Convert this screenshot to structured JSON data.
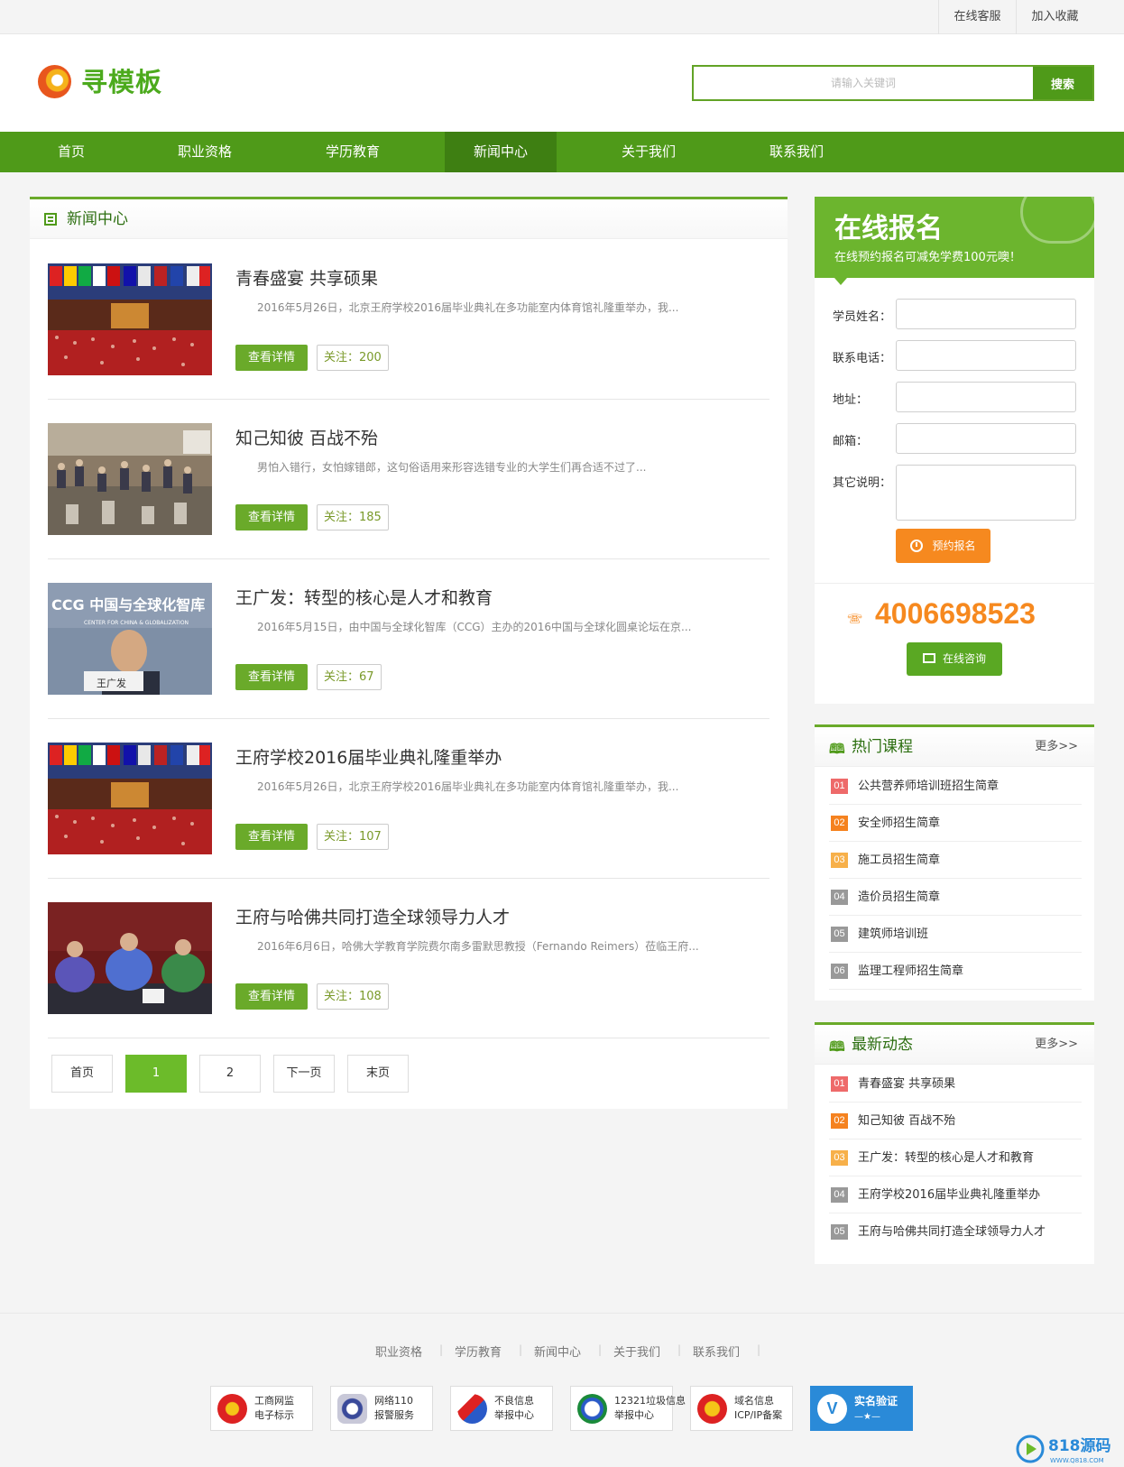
{
  "topbar": {
    "links": [
      "在线客服",
      "加入收藏"
    ]
  },
  "header": {
    "logo_text": "寻模板",
    "search_placeholder": "请输入关键词",
    "search_button": "搜索"
  },
  "nav": {
    "items": [
      "首页",
      "职业资格",
      "学历教育",
      "新闻中心",
      "关于我们",
      "联系我们"
    ],
    "active": "新闻中心"
  },
  "main": {
    "section_title": "新闻中心",
    "articles": [
      {
        "title": "青春盛宴 共享硕果",
        "desc": "2016年5月26日，北京王府学校2016届毕业典礼在多功能室内体育馆礼隆重举办，我...",
        "button": "查看详情",
        "follow": "关注：200"
      },
      {
        "title": "知己知彼 百战不殆",
        "desc": "男怕入错行，女怕嫁错郎，这句俗语用来形容选错专业的大学生们再合适不过了...",
        "button": "查看详情",
        "follow": "关注：185"
      },
      {
        "title": "王广发：转型的核心是人才和教育",
        "desc": "2016年5月15日，由中国与全球化智库（CCG）主办的2016中国与全球化圆桌论坛在京...",
        "button": "查看详情",
        "follow": "关注：67"
      },
      {
        "title": "王府学校2016届毕业典礼隆重举办",
        "desc": "2016年5月26日，北京王府学校2016届毕业典礼在多功能室内体育馆礼隆重举办，我...",
        "button": "查看详情",
        "follow": "关注：107"
      },
      {
        "title": "王府与哈佛共同打造全球领导力人才",
        "desc": "2016年6月6日，哈佛大学教育学院费尔南多雷默思教授（Fernando Reimers）莅临王府...",
        "button": "查看详情",
        "follow": "关注：108"
      }
    ],
    "image_texts": {
      "ccg": "CCG 中国与全球化智库",
      "ccg_sub": "CENTER FOR CHINA & GLOBALIZATION",
      "name_card": "王广发"
    },
    "pager": [
      "首页",
      "1",
      "2",
      "下一页",
      "末页"
    ]
  },
  "signup": {
    "title": "在线报名",
    "subtitle": "在线预约报名可减免学费100元噢！",
    "fields": [
      "学员姓名：",
      "联系电话：",
      "地址：",
      "邮箱：",
      "其它说明："
    ],
    "submit": "预约报名",
    "phone": "4006698523",
    "consult": "在线咨询"
  },
  "hot_courses": {
    "title": "热门课程",
    "more": "更多>>",
    "items": [
      {
        "num": "01",
        "text": "公共营养师培训班招生简章"
      },
      {
        "num": "02",
        "text": "安全师招生简章"
      },
      {
        "num": "03",
        "text": "施工员招生简章"
      },
      {
        "num": "04",
        "text": "造价员招生简章"
      },
      {
        "num": "05",
        "text": "建筑师培训班"
      },
      {
        "num": "06",
        "text": "监理工程师招生简章"
      }
    ]
  },
  "latest_news": {
    "title": "最新动态",
    "more": "更多>>",
    "items": [
      {
        "num": "01",
        "text": "青春盛宴 共享硕果"
      },
      {
        "num": "02",
        "text": "知己知彼 百战不殆"
      },
      {
        "num": "03",
        "text": "王广发：转型的核心是人才和教育"
      },
      {
        "num": "04",
        "text": "王府学校2016届毕业典礼隆重举办"
      },
      {
        "num": "05",
        "text": "王府与哈佛共同打造全球领导力人才"
      }
    ]
  },
  "footer": {
    "links": [
      "职业资格",
      "学历教育",
      "新闻中心",
      "关于我们",
      "联系我们"
    ],
    "badges": [
      {
        "l1": "工商网监",
        "l2": "电子标示"
      },
      {
        "l1": "网络110",
        "l2": "报警服务"
      },
      {
        "l1": "不良信息",
        "l2": "举报中心"
      },
      {
        "l1": "12321垃圾信息",
        "l2": "举报中心"
      },
      {
        "l1": "域名信息",
        "l2": "ICP/IP备案"
      },
      {
        "l1": "实名验证",
        "l2": "—★—"
      }
    ]
  },
  "corner": {
    "brand": "818源码",
    "url": "WWW.Q818.COM"
  },
  "colors": {
    "green": "#4f9a19",
    "orange": "#f6891f",
    "num_colors": [
      "#ee6a6a",
      "#f5821f",
      "#f7b04a",
      "#999999",
      "#999999",
      "#999999"
    ]
  }
}
